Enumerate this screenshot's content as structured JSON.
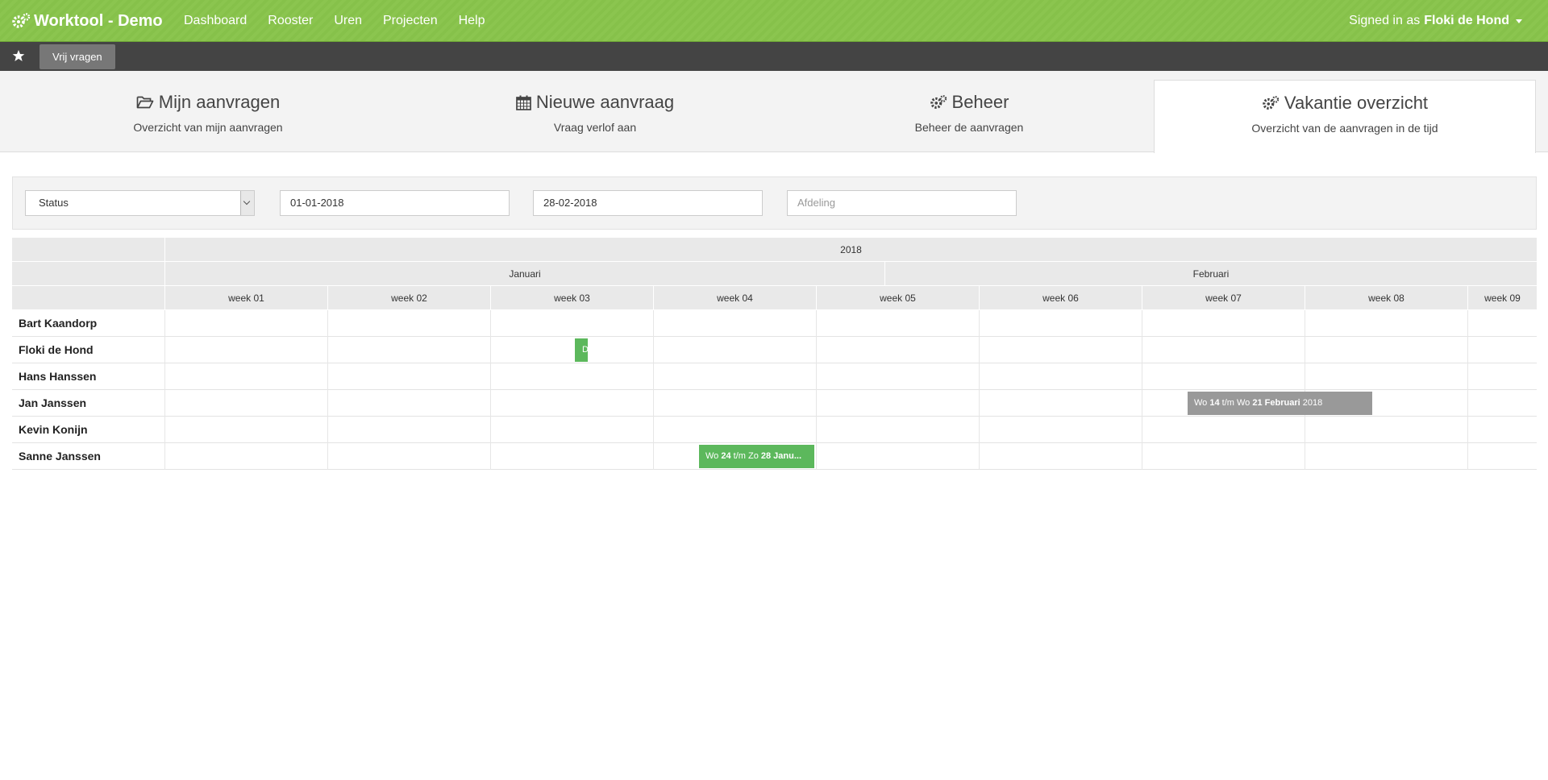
{
  "navbar": {
    "brand": "Worktool - Demo",
    "links": [
      "Dashboard",
      "Rooster",
      "Uren",
      "Projecten",
      "Help"
    ],
    "user_prefix": "Signed in as",
    "user_name": "Floki de Hond"
  },
  "subbar": {
    "button": "Vrij vragen"
  },
  "tabs": [
    {
      "title": "Mijn aanvragen",
      "subtitle": "Overzicht van mijn aanvragen",
      "icon": "folder-open-icon"
    },
    {
      "title": "Nieuwe aanvraag",
      "subtitle": "Vraag verlof aan",
      "icon": "calendar-icon"
    },
    {
      "title": "Beheer",
      "subtitle": "Beheer de aanvragen",
      "icon": "gears-icon"
    },
    {
      "title": "Vakantie overzicht",
      "subtitle": "Overzicht van de aanvragen in de tijd",
      "icon": "gears-icon",
      "active": true
    }
  ],
  "filters": {
    "status": "Status",
    "date_from": "01-01-2018",
    "date_to": "28-02-2018",
    "department_placeholder": "Afdeling"
  },
  "gantt": {
    "year": "2018",
    "months": [
      "Januari",
      "Februari"
    ],
    "weeks": [
      "week 01",
      "week 02",
      "week 03",
      "week 04",
      "week 05",
      "week 06",
      "week 07",
      "week 08",
      "week 09"
    ],
    "people": [
      "Bart Kaandorp",
      "Floki de Hond",
      "Hans Hanssen",
      "Jan Janssen",
      "Kevin Konijn",
      "Sanne Janssen"
    ],
    "bars": [
      {
        "person": "Floki de Hond",
        "label": "D",
        "color": "#5cb85c"
      },
      {
        "person": "Jan Janssen",
        "p1": "Wo ",
        "b1": "14",
        "p2": " t/m Wo ",
        "b2": "21 Februari",
        "p3": " 2018",
        "color": "#999999"
      },
      {
        "person": "Sanne Janssen",
        "p1": "Wo ",
        "b1": "24",
        "p2": " t/m Zo ",
        "b2": "28 Janu...",
        "color": "#5cb85c"
      }
    ]
  }
}
